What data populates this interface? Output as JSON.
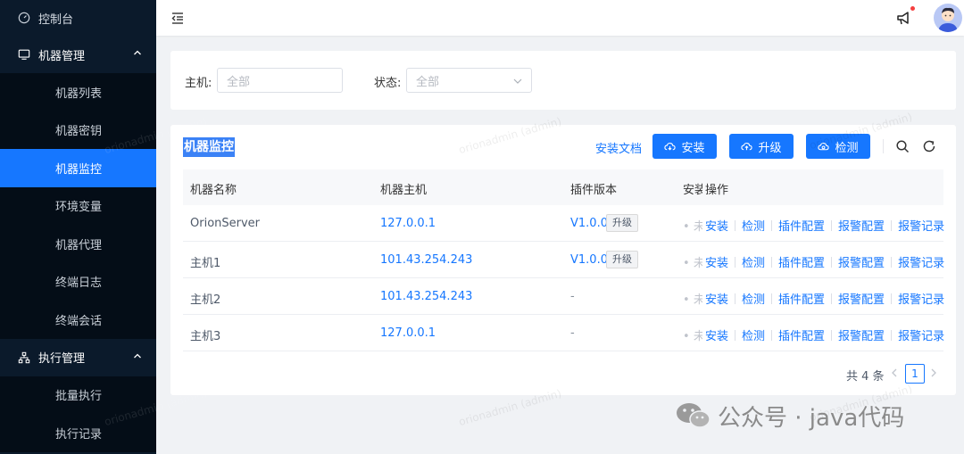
{
  "sidebar": {
    "dashboard": "控制台",
    "machine_group": "机器管理",
    "machine_items": [
      "机器列表",
      "机器密钥",
      "机器监控",
      "环境变量",
      "机器代理",
      "终端日志",
      "终端会话"
    ],
    "exec_group": "执行管理",
    "exec_items": [
      "批量执行",
      "执行记录"
    ],
    "active_item": "机器监控"
  },
  "header": {
    "notification_dot_color": "#f53f3f"
  },
  "filter": {
    "host_label": "主机:",
    "host_placeholder": "全部",
    "status_label": "状态:",
    "status_value": "全部"
  },
  "card": {
    "title": "机器监控",
    "doc_link": "安装文档",
    "install_btn": "安装",
    "upgrade_btn": "升级",
    "check_btn": "检测"
  },
  "table": {
    "columns": [
      "机器名称",
      "机器主机",
      "插件版本",
      "安装",
      "操作"
    ],
    "rows": [
      {
        "name": "OrionServer",
        "host": "127.0.0.1",
        "version": "V1.0.0",
        "upgrade_tag": "升级",
        "status": "未"
      },
      {
        "name": "主机1",
        "host": "101.43.254.243",
        "version": "V1.0.0",
        "upgrade_tag": "升级",
        "status": "未"
      },
      {
        "name": "主机2",
        "host": "101.43.254.243",
        "version": "-",
        "upgrade_tag": "",
        "status": "未"
      },
      {
        "name": "主机3",
        "host": "127.0.0.1",
        "version": "-",
        "upgrade_tag": "",
        "status": "未"
      }
    ],
    "actions": [
      "安装",
      "检测",
      "插件配置",
      "报警配置",
      "报警记录"
    ]
  },
  "pagination": {
    "total": "共 4 条",
    "current_page": "1"
  },
  "watermark": "orionadmin (admin)",
  "brand": {
    "text": "公众号 · java代码"
  },
  "colors": {
    "primary": "#1677ff",
    "sidebar_bg": "#0b1a2b",
    "submenu_bg": "#040d17",
    "page_bg": "#f0f2f5"
  }
}
